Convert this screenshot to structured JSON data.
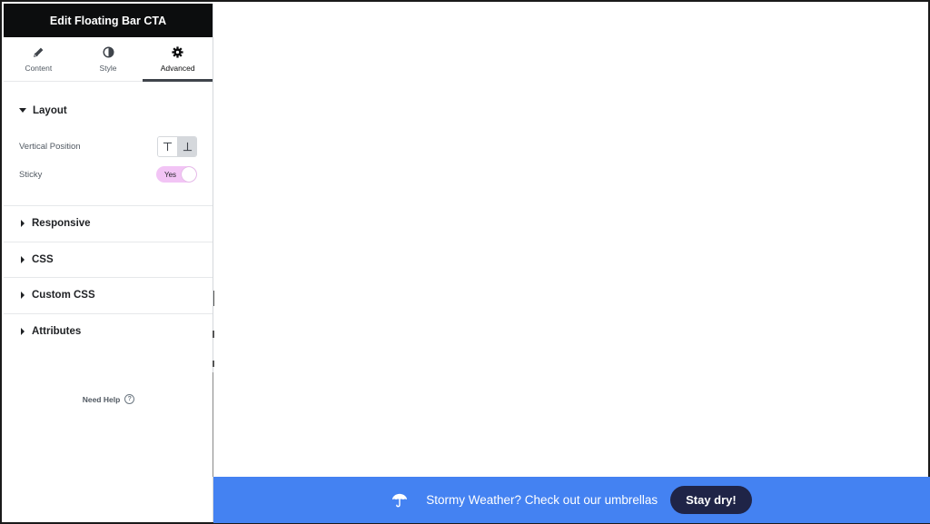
{
  "panel": {
    "title": "Edit Floating Bar CTA",
    "tabs": [
      {
        "label": "Content",
        "icon": "pencil-icon"
      },
      {
        "label": "Style",
        "icon": "half-circle-icon"
      },
      {
        "label": "Advanced",
        "icon": "gear-icon",
        "active": true
      }
    ],
    "sections": {
      "layout": {
        "title": "Layout",
        "vertical_position_label": "Vertical Position",
        "vertical_position_value": "bottom",
        "sticky_label": "Sticky",
        "sticky_value": "Yes"
      },
      "responsive": "Responsive",
      "css": "CSS",
      "custom_css": "Custom CSS",
      "attributes": "Attributes"
    },
    "help_label": "Need Help"
  },
  "floating_bar": {
    "text": "Stormy Weather? Check out our umbrellas",
    "button_label": "Stay dry!",
    "icon": "umbrella-icon",
    "background_color": "#4482f2",
    "button_color": "#1f2447"
  },
  "colors": {
    "panel_header": "#0c0d0e",
    "toggle_on": "#f2c4f5"
  }
}
